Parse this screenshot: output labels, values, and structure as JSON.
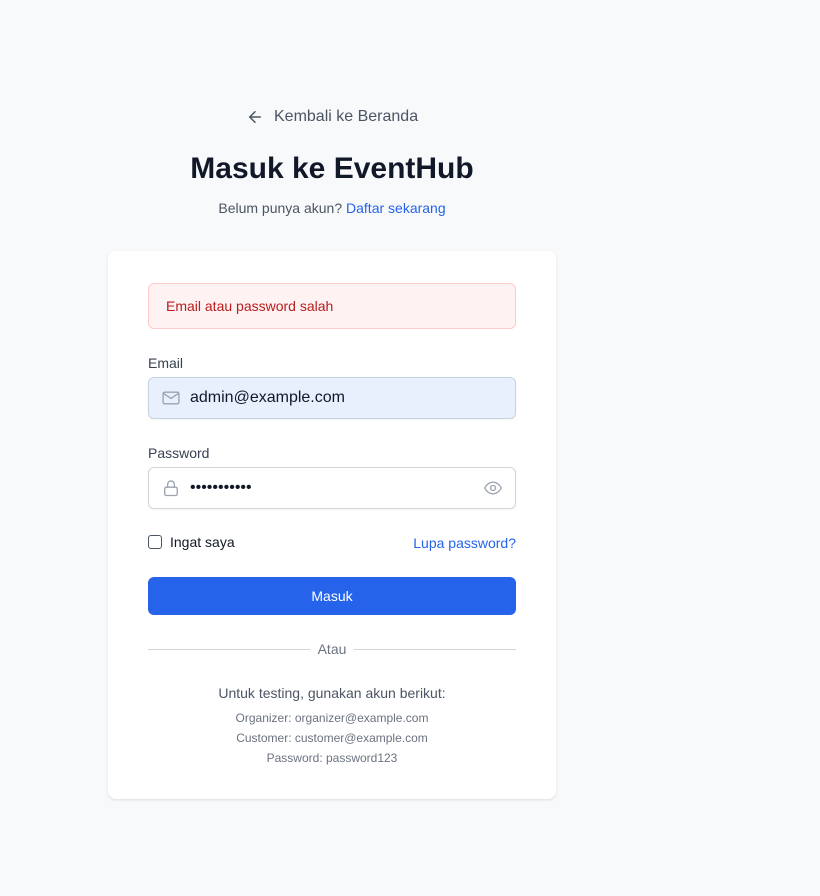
{
  "nav": {
    "back_label": "Kembali ke Beranda"
  },
  "header": {
    "title": "Masuk ke EventHub",
    "subtitle_prefix": "Belum punya akun?",
    "register_link": "Daftar sekarang"
  },
  "alert": {
    "message": "Email atau password salah"
  },
  "form": {
    "email_label": "Email",
    "email_value": "admin@example.com",
    "password_label": "Password",
    "password_value": "password123",
    "remember_label": "Ingat saya",
    "forgot_link": "Lupa password?",
    "submit_label": "Masuk",
    "divider_text": "Atau"
  },
  "test_accounts": {
    "title": "Untuk testing, gunakan akun berikut:",
    "lines": [
      "Organizer: organizer@example.com",
      "Customer: customer@example.com",
      "Password: password123"
    ]
  },
  "icons": {
    "back": "arrow-left-icon",
    "email": "mail-icon",
    "password": "lock-icon",
    "toggle": "eye-icon"
  },
  "colors": {
    "primary": "#2563eb",
    "error_bg": "#fef2f2",
    "error_text": "#b91c1c",
    "background": "#f8f9fb"
  }
}
